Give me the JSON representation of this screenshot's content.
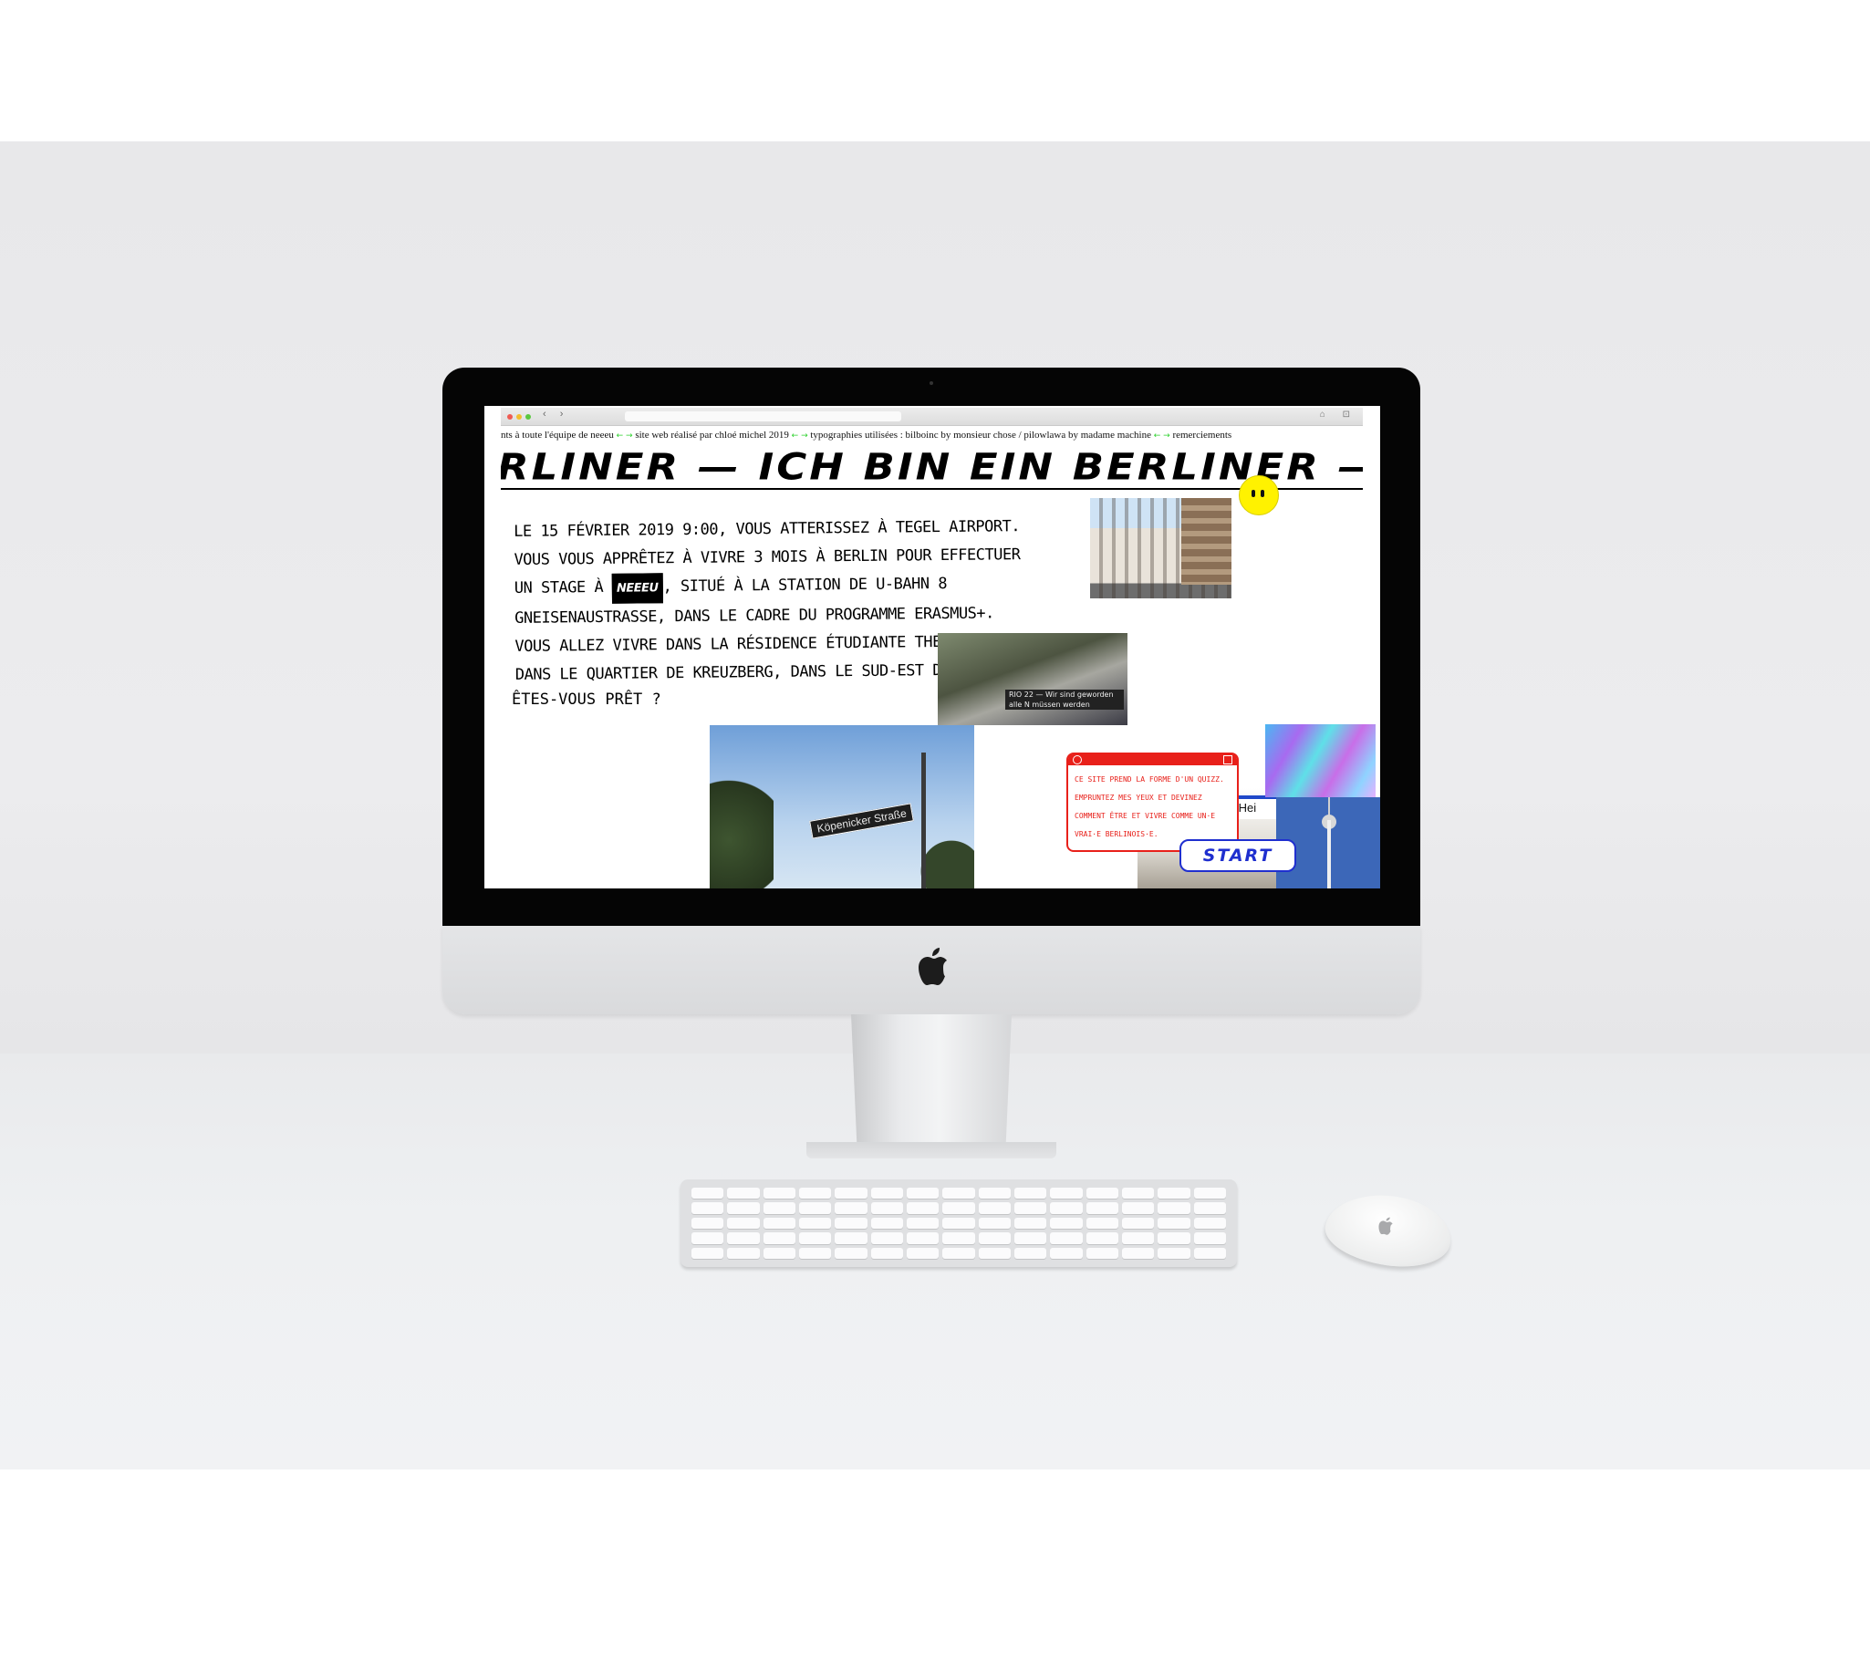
{
  "browser": {
    "nav_back": "‹",
    "nav_forward": "›",
    "toolbar_icons": "⌂ ⊡"
  },
  "ticker": {
    "item_1": "nts à toute l'équipe de neeeu",
    "item_2": "site web réalisé par chloé michel 2019",
    "item_3": "typographies utilisées : bilboinc by monsieur chose / pilowlawa by madame machine",
    "item_4": "remerciements",
    "separator": "← →",
    "separator_color": "#2bd12b"
  },
  "marquee": {
    "text": "RLINER — ICH BIN EIN BERLINER — ICH"
  },
  "intro": {
    "text_before": "Le 15 février 2019 9:00, vous atterissez à Tegel Airport. Vous vous apprêtez à vivre 3 mois à Berlin pour effectuer un stage à",
    "brand": "neeeu",
    "text_after": ", situé à la station de U-Bahn 8 Gneisenaustraße, dans le cadre du programme Erasmus+. Vous allez vivre dans la résidence étudiante The Fizz, dans le quartier de Kreuzberg, dans le sud-est de Berlin.",
    "question": "Êtes-vous prêt ?"
  },
  "photos": {
    "graffiti_banner": "RIO 22 — Wir sind geworden alle N müssen werden",
    "street_sign": "Köpenicker Straße",
    "station_sign": "r-Hei"
  },
  "quiz": {
    "text": "Ce site prend la forme d'un quizz. Empruntez mes yeux et devinez comment être et vivre comme un·e vrai·e berlinois·e.",
    "start_label": "START",
    "accent_color": "#e8201a",
    "button_color": "#1f2fcf"
  },
  "smiley_color": "#fff200"
}
